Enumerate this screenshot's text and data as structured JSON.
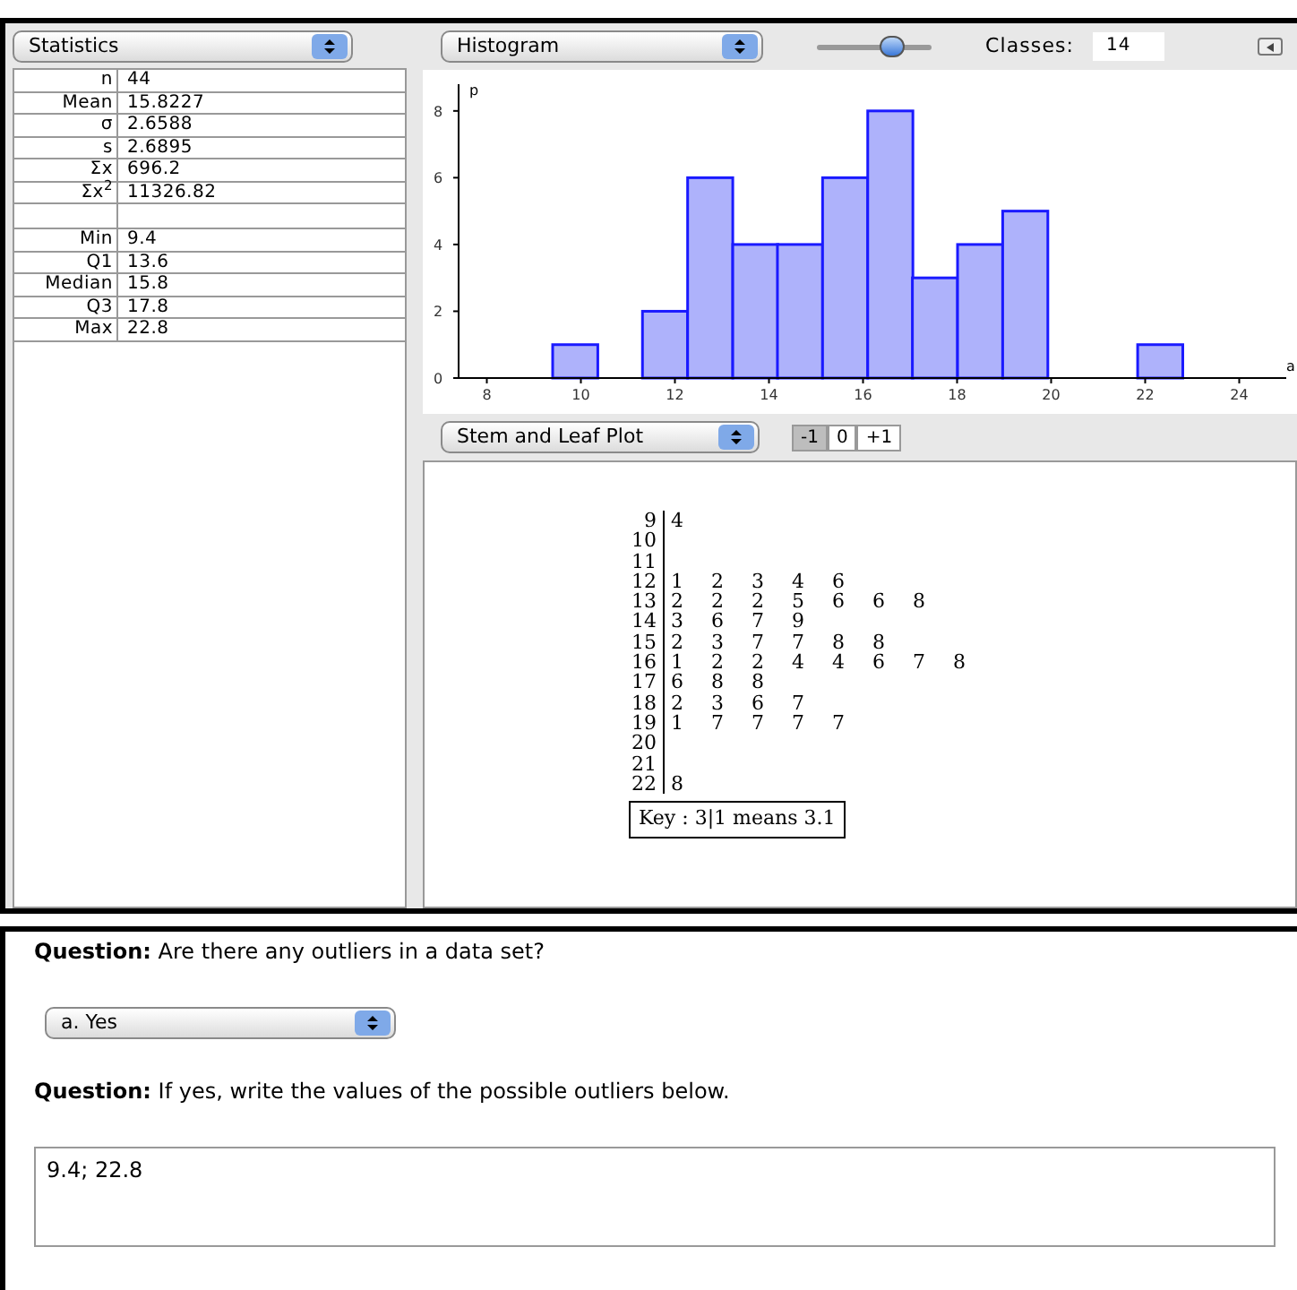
{
  "statistics_panel": {
    "dropdown": "Statistics",
    "rows": [
      {
        "label": "n",
        "value": "44"
      },
      {
        "label": "Mean",
        "value": "15.8227"
      },
      {
        "label": "σ",
        "value": "2.6588"
      },
      {
        "label": "s",
        "value": "2.6895"
      },
      {
        "label": "Σx",
        "value": "696.2"
      },
      {
        "label": "Σx$^{2}$",
        "value": "11326.82"
      },
      {
        "kind": "blank"
      },
      {
        "label": "Min",
        "value": "9.4"
      },
      {
        "label": "Q1",
        "value": "13.6"
      },
      {
        "label": "Median",
        "value": "15.8"
      },
      {
        "label": "Q3",
        "value": "17.8"
      },
      {
        "label": "Max",
        "value": "22.8"
      }
    ]
  },
  "histogram_panel": {
    "dropdown": "Histogram",
    "slider": {
      "level": 0.65
    },
    "classes_label": "Classes:",
    "classes_value": "14",
    "chart_data": {
      "type": "bar",
      "ylabel": "p",
      "xlabel": "a",
      "x": [
        9.88,
        10.84,
        11.79,
        12.75,
        13.71,
        14.66,
        15.62,
        16.58,
        17.53,
        18.49,
        19.45,
        20.4,
        21.36,
        22.32
      ],
      "values": [
        1,
        0,
        2,
        6,
        4,
        4,
        6,
        8,
        3,
        4,
        5,
        0,
        0,
        1
      ],
      "xlim": [
        7.4,
        25
      ],
      "ylim": [
        0,
        8.8
      ],
      "xticks": [
        8,
        10,
        12,
        14,
        16,
        18,
        20,
        22,
        24
      ],
      "yticks": [
        0,
        2,
        4,
        6,
        8
      ]
    }
  },
  "stem_leaf_panel": {
    "dropdown": "Stem and Leaf Plot",
    "adjust_buttons": [
      {
        "label": "-1",
        "selected": true
      },
      {
        "label": "0",
        "selected": false
      },
      {
        "label": "+1",
        "selected": false
      }
    ],
    "rows": [
      {
        "stem": "9",
        "leaves": [
          "4"
        ]
      },
      {
        "stem": "10",
        "leaves": []
      },
      {
        "stem": "11",
        "leaves": []
      },
      {
        "stem": "12",
        "leaves": [
          "1",
          "2",
          "3",
          "4",
          "6"
        ]
      },
      {
        "stem": "13",
        "leaves": [
          "2",
          "2",
          "2",
          "5",
          "6",
          "6",
          "8"
        ]
      },
      {
        "stem": "14",
        "leaves": [
          "3",
          "6",
          "7",
          "9"
        ]
      },
      {
        "stem": "15",
        "leaves": [
          "2",
          "3",
          "7",
          "7",
          "8",
          "8"
        ]
      },
      {
        "stem": "16",
        "leaves": [
          "1",
          "2",
          "2",
          "4",
          "4",
          "6",
          "7",
          "8"
        ]
      },
      {
        "stem": "17",
        "leaves": [
          "6",
          "8",
          "8"
        ]
      },
      {
        "stem": "18",
        "leaves": [
          "2",
          "3",
          "6",
          "7"
        ]
      },
      {
        "stem": "19",
        "leaves": [
          "1",
          "7",
          "7",
          "7",
          "7"
        ]
      },
      {
        "stem": "20",
        "leaves": []
      },
      {
        "stem": "21",
        "leaves": []
      },
      {
        "stem": "22",
        "leaves": [
          "8"
        ]
      }
    ],
    "key": "Key :  3|1 means 3.1"
  },
  "questions": [
    {
      "kind": "choice",
      "prompt_label": "Question:",
      "prompt": "Are there any outliers in a data set?",
      "answer": "a. Yes"
    },
    {
      "kind": "text",
      "prompt_label": "Question:",
      "prompt": "If yes, write the values of the possible outliers below.",
      "answer": "9.4; 22.8"
    }
  ]
}
